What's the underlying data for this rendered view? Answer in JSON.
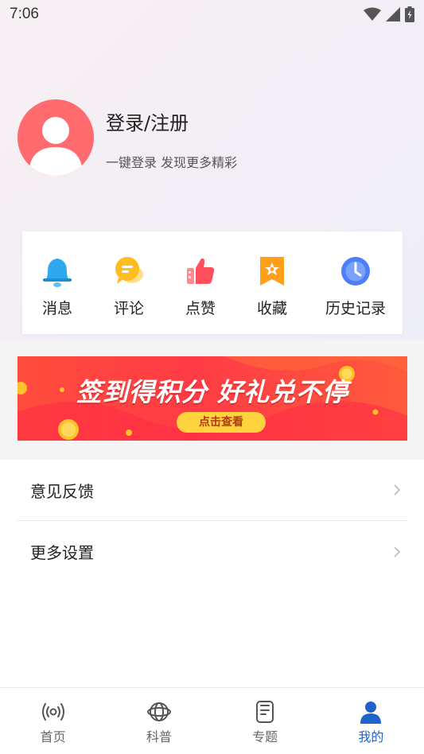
{
  "status_bar": {
    "time": "7:06"
  },
  "profile": {
    "login_title": "登录/注册",
    "login_subtitle": "一键登录 发现更多精彩"
  },
  "quick_actions": [
    {
      "label": "消息",
      "icon": "bell-icon"
    },
    {
      "label": "评论",
      "icon": "comment-icon"
    },
    {
      "label": "点赞",
      "icon": "thumbs-up-icon"
    },
    {
      "label": "收藏",
      "icon": "favorite-icon"
    },
    {
      "label": "历史记录",
      "icon": "clock-icon"
    }
  ],
  "banner": {
    "text": "签到得积分 好礼兑不停",
    "button": "点击查看"
  },
  "settings": [
    {
      "label": "意见反馈"
    },
    {
      "label": "更多设置"
    }
  ],
  "tabs": [
    {
      "label": "首页",
      "icon": "radio-icon",
      "active": false
    },
    {
      "label": "科普",
      "icon": "globe-icon",
      "active": false
    },
    {
      "label": "专题",
      "icon": "document-icon",
      "active": false
    },
    {
      "label": "我的",
      "icon": "user-icon",
      "active": true
    }
  ],
  "colors": {
    "accent": "#1e64c8",
    "avatar_bg": "#ff6b6f",
    "banner_red": "#ff3b45"
  }
}
